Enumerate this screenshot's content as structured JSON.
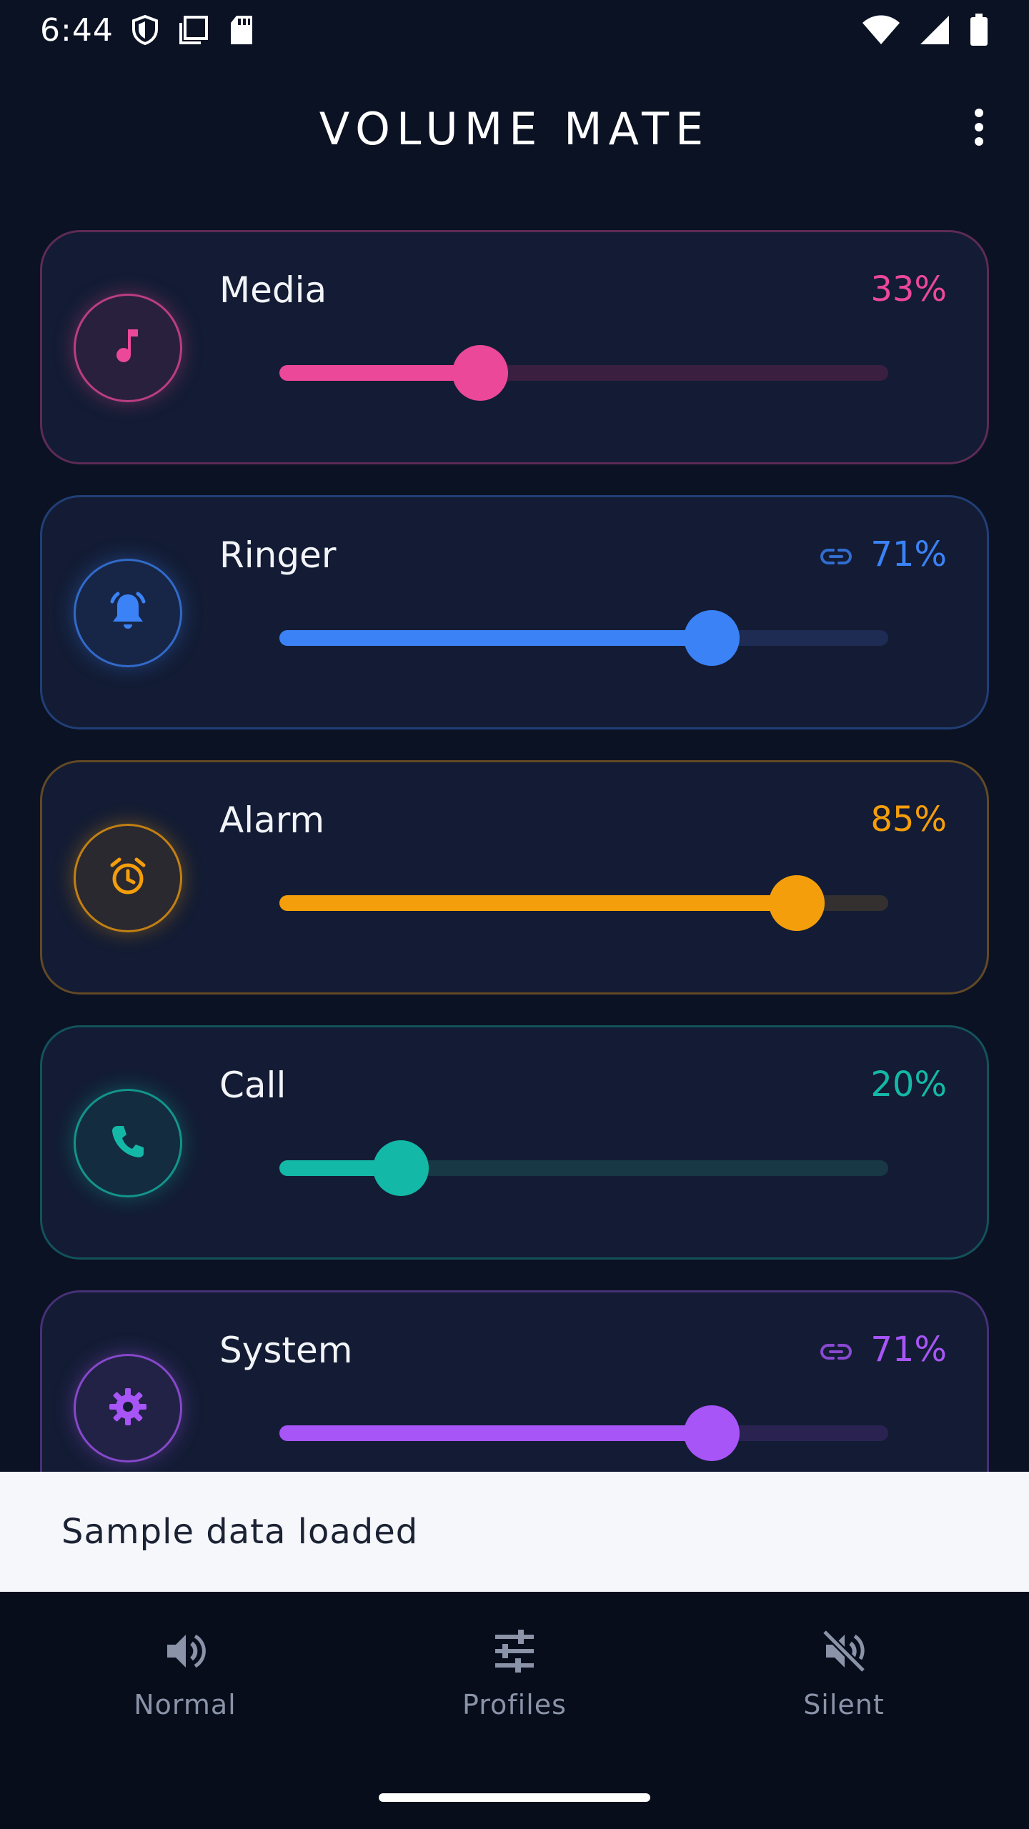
{
  "status_bar": {
    "time": "6:44"
  },
  "header": {
    "title": "VOLUME MATE"
  },
  "channels": [
    {
      "label": "Media",
      "percent_text": "33%",
      "value": 0.33,
      "linked": false,
      "color": "#ec4899",
      "track": "#3a1f40",
      "icon": "music-note-icon"
    },
    {
      "label": "Ringer",
      "percent_text": "71%",
      "value": 0.71,
      "linked": true,
      "color": "#3b82f6",
      "track": "#1e2b52",
      "icon": "bell-icon"
    },
    {
      "label": "Alarm",
      "percent_text": "85%",
      "value": 0.85,
      "linked": false,
      "color": "#f59e0b",
      "track": "#33302f",
      "icon": "alarm-clock-icon"
    },
    {
      "label": "Call",
      "percent_text": "20%",
      "value": 0.2,
      "linked": false,
      "color": "#14b8a6",
      "track": "#173844",
      "icon": "phone-icon"
    },
    {
      "label": "System",
      "percent_text": "71%",
      "value": 0.71,
      "linked": true,
      "color": "#a855f7",
      "track": "#2a2352",
      "icon": "gear-icon"
    }
  ],
  "snackbar": {
    "message": "Sample data loaded"
  },
  "bottom_nav": {
    "items": [
      {
        "label": "Normal",
        "icon": "speaker-icon"
      },
      {
        "label": "Profiles",
        "icon": "sliders-icon"
      },
      {
        "label": "Silent",
        "icon": "speaker-muted-icon"
      }
    ]
  }
}
